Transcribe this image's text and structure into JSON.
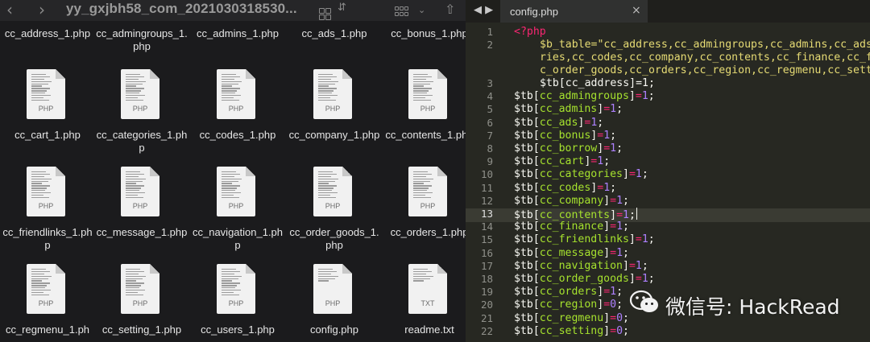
{
  "finder": {
    "title": "yy_gxjbh58_com_2021030318530...",
    "files": [
      {
        "name": "cc_address_1.php",
        "ext": ""
      },
      {
        "name": "cc_admingroups_1.php",
        "ext": ""
      },
      {
        "name": "cc_admins_1.php",
        "ext": ""
      },
      {
        "name": "cc_ads_1.php",
        "ext": ""
      },
      {
        "name": "cc_bonus_1.php",
        "ext": ""
      },
      {
        "name": "cc_cart_1.php",
        "ext": "PHP"
      },
      {
        "name": "cc_categories_1.php",
        "ext": "PHP"
      },
      {
        "name": "cc_codes_1.php",
        "ext": "PHP"
      },
      {
        "name": "cc_company_1.php",
        "ext": "PHP"
      },
      {
        "name": "cc_contents_1.php",
        "ext": "PHP"
      },
      {
        "name": "cc_friendlinks_1.php",
        "ext": "PHP"
      },
      {
        "name": "cc_message_1.php",
        "ext": "PHP"
      },
      {
        "name": "cc_navigation_1.php",
        "ext": "PHP"
      },
      {
        "name": "cc_order_goods_1.php",
        "ext": "PHP"
      },
      {
        "name": "cc_orders_1.php",
        "ext": "PHP"
      },
      {
        "name": "cc_regmenu_1.ph",
        "ext": "PHP"
      },
      {
        "name": "cc_setting_1.php",
        "ext": "PHP"
      },
      {
        "name": "cc_users_1.php",
        "ext": "PHP"
      },
      {
        "name": "config.php",
        "ext": "PHP"
      },
      {
        "name": "readme.txt",
        "ext": "TXT"
      }
    ]
  },
  "editor": {
    "tab_name": "config.php",
    "nav_arrows": "◀ ▶",
    "close_icon": "×",
    "active_line": "13",
    "line_numbers": [
      "1",
      "2",
      "3",
      "4",
      "5",
      "6",
      "7",
      "8",
      "9",
      "10",
      "11",
      "12",
      "13",
      "14",
      "15",
      "16",
      "17",
      "18",
      "19",
      "20",
      "21",
      "22"
    ],
    "code": {
      "l1": "<?php",
      "l2a": "$b_table=\"cc_address,cc_admingroups,cc_admins,cc_ads,c",
      "l2b": "ries,cc_codes,cc_company,cc_contents,cc_finance,cc_fri",
      "l2c": "c_order_goods,cc_orders,cc_region,cc_regmenu,cc_setting",
      "l3": "$tb[cc_address]=1;",
      "rows": [
        {
          "key": "cc_admingroups",
          "val": "1"
        },
        {
          "key": "cc_admins",
          "val": "1"
        },
        {
          "key": "cc_ads",
          "val": "1"
        },
        {
          "key": "cc_bonus",
          "val": "1"
        },
        {
          "key": "cc_borrow",
          "val": "1"
        },
        {
          "key": "cc_cart",
          "val": "1"
        },
        {
          "key": "cc_categories",
          "val": "1"
        },
        {
          "key": "cc_codes",
          "val": "1"
        },
        {
          "key": "cc_company",
          "val": "1"
        },
        {
          "key": "cc_contents",
          "val": "1"
        },
        {
          "key": "cc_finance",
          "val": "1"
        },
        {
          "key": "cc_friendlinks",
          "val": "1"
        },
        {
          "key": "cc_message",
          "val": "1"
        },
        {
          "key": "cc_navigation",
          "val": "1"
        },
        {
          "key": "cc_order_goods",
          "val": "1"
        },
        {
          "key": "cc_orders",
          "val": "1"
        },
        {
          "key": "cc_region",
          "val": "0"
        },
        {
          "key": "cc_regmenu",
          "val": "0"
        },
        {
          "key": "cc_setting",
          "val": "0"
        }
      ]
    }
  },
  "watermark": {
    "text": "微信号: HackRead"
  },
  "colors": {
    "string": "#e6db74",
    "keyword": "#f92672",
    "number": "#ae81ff",
    "function": "#a6e22e"
  }
}
